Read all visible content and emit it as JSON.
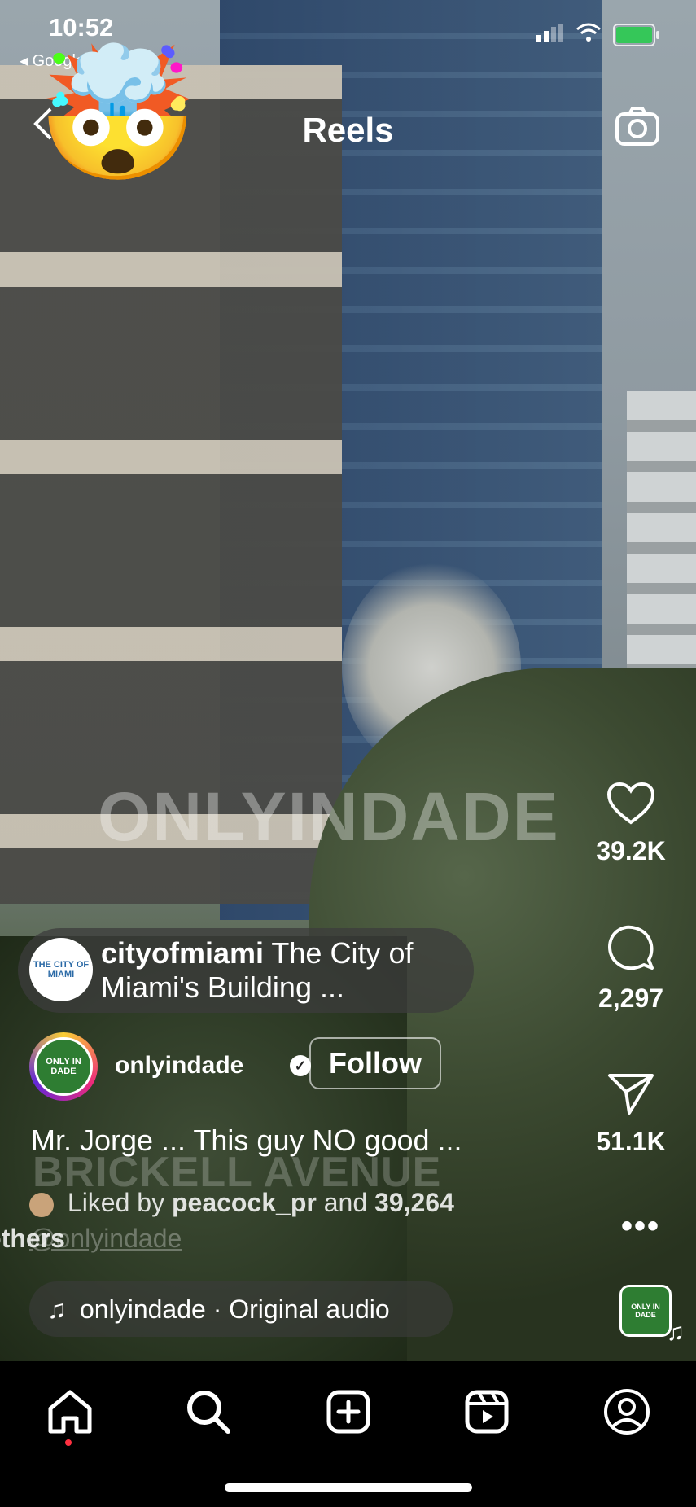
{
  "status_bar": {
    "time": "10:52",
    "back_app": "◂ Google"
  },
  "header": {
    "title": "Reels",
    "back_icon": "chevron-left-icon",
    "camera_icon": "camera-icon"
  },
  "overlay": {
    "emoji": "🤯",
    "watermark": "ONLYINDADE",
    "location_watermark": "BRICKELL AVENUE"
  },
  "actions": {
    "likes": "39.2K",
    "comments": "2,297",
    "shares": "51.1K"
  },
  "caption_pill": {
    "account": "cityofmiami",
    "text": "The City of Miami's Building ...",
    "logo_text": "THE CITY OF MIAMI"
  },
  "author": {
    "name": "onlyindade",
    "avatar_text": "ONLY IN DADE",
    "follow_label": "Follow"
  },
  "description": "Mr. Jorge ... This guy NO good ...",
  "liked_by": {
    "prefix": "Liked by",
    "user": "peacock_pr",
    "middle": "and",
    "count": "39,264",
    "suffix": "others",
    "tag": "@onlyindade"
  },
  "audio": {
    "label": "onlyindade · Original audio",
    "thumb_text": "ONLY IN DADE"
  },
  "tabs": [
    "home-icon",
    "search-icon",
    "create-icon",
    "reels-icon",
    "profile-icon"
  ],
  "colors": {
    "tabbar": "#000000",
    "notification_dot": "#ff3040",
    "battery": "#35c759"
  }
}
